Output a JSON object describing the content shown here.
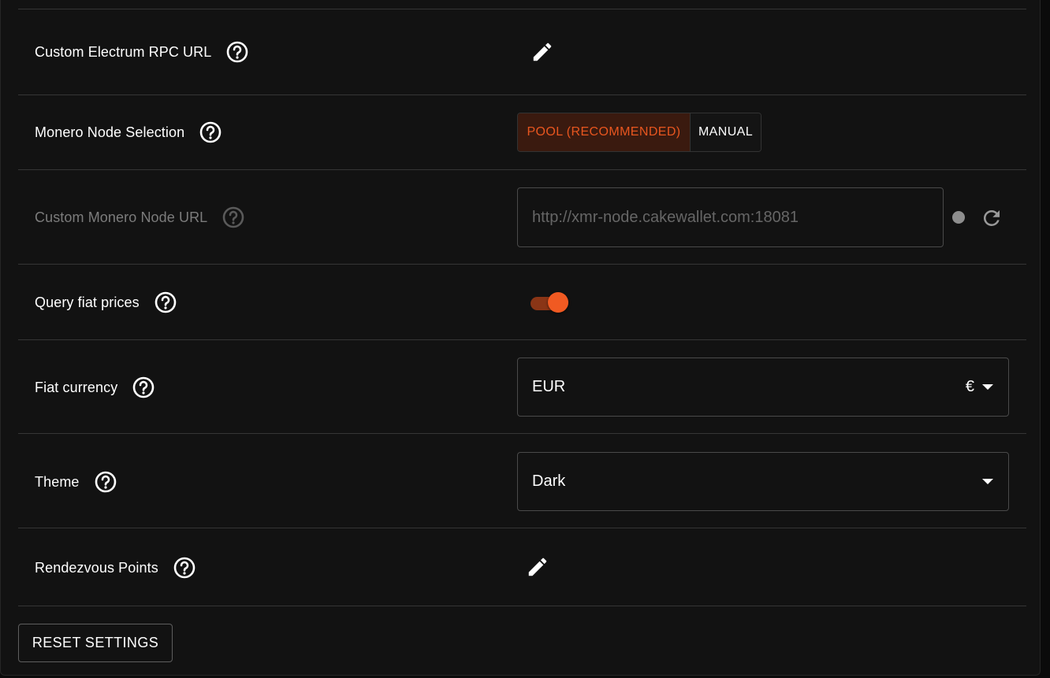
{
  "settings": {
    "electrum_rpc": {
      "label": "Custom Electrum RPC URL"
    },
    "monero_node_selection": {
      "label": "Monero Node Selection",
      "options": [
        "POOL (RECOMMENDED)",
        "MANUAL"
      ],
      "selected": "POOL (RECOMMENDED)"
    },
    "custom_monero_node": {
      "label": "Custom Monero Node URL",
      "placeholder": "http://xmr-node.cakewallet.com:18081",
      "value": ""
    },
    "query_fiat_prices": {
      "label": "Query fiat prices",
      "enabled": true
    },
    "fiat_currency": {
      "label": "Fiat currency",
      "value": "EUR",
      "symbol": "€"
    },
    "theme": {
      "label": "Theme",
      "value": "Dark"
    },
    "rendezvous_points": {
      "label": "Rendezvous Points"
    }
  },
  "actions": {
    "reset_label": "RESET SETTINGS"
  },
  "icons": {
    "help": "help-circle-icon",
    "edit": "pencil-icon",
    "refresh": "refresh-icon",
    "dropdown": "chevron-down-icon"
  },
  "colors": {
    "accent": "#f05a22",
    "accent_dark": "#8a3516",
    "selected_bg": "#3a1a0f",
    "background": "#121212",
    "divider": "#353535",
    "disabled_text": "#7c7c7c"
  }
}
